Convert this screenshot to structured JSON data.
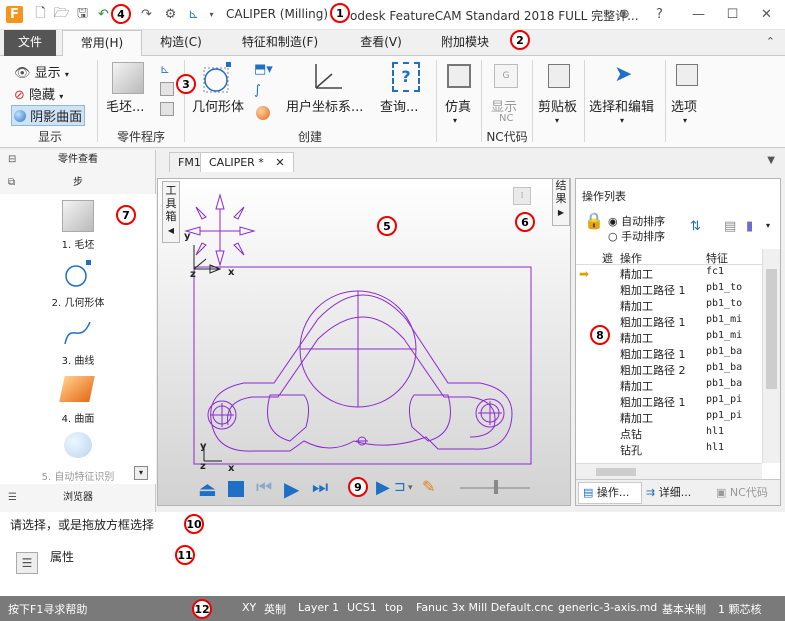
{
  "window": {
    "title_prefix": "CALIPER (Milling) -",
    "title_suffix": "odesk FeatureCAM Standard 2018 FULL 完整许..."
  },
  "menu_tabs": [
    {
      "label": "文件"
    },
    {
      "label": "常用(H)"
    },
    {
      "label": "构造(C)"
    },
    {
      "label": "特征和制造(F)"
    },
    {
      "label": "查看(V)"
    },
    {
      "label": "附加模块"
    }
  ],
  "ribbon": {
    "show": {
      "show_label": "显示",
      "hide_label": "隐藏",
      "shaded_label": "阴影曲面",
      "group_label": "显示"
    },
    "part_program": {
      "stock_label": "毛坯...",
      "group_label": "零件程序"
    },
    "create": {
      "geometry_label": "几何形体",
      "ucs_label": "用户坐标系...",
      "query_label": "查询...",
      "group_label": "创建"
    },
    "simulate_label": "仿真",
    "nc": {
      "show_label": "显示",
      "nc_small": "NC",
      "group_label": "NC代码"
    },
    "clipboard_label": "剪贴板",
    "select_edit_label": "选择和编辑",
    "options_label": "选项"
  },
  "sidebar": {
    "part_view_label": "零件查看",
    "steps_label": "步",
    "steps": [
      {
        "label": "1. 毛坯"
      },
      {
        "label": "2. 几何形体"
      },
      {
        "label": "3. 曲线"
      },
      {
        "label": "4. 曲面"
      },
      {
        "label": "5. 自动特征识别"
      }
    ],
    "browser_label": "浏览器"
  },
  "doc_tabs": [
    {
      "label": "FM1"
    },
    {
      "label": "CALIPER *"
    }
  ],
  "viewport": {
    "toolbox_label": "工具箱",
    "results_label": "结果",
    "axis_x": "x",
    "axis_y": "y",
    "axis_z": "z"
  },
  "operations": {
    "title": "操作列表",
    "auto_sort": "自动排序",
    "manual_sort": "手动排序",
    "col_mark": "遮",
    "col_op": "操作",
    "col_feature": "特征",
    "rows": [
      {
        "op": "精加工",
        "feature": "fc1"
      },
      {
        "op": "粗加工路径 1",
        "feature": "pb1_to"
      },
      {
        "op": "精加工",
        "feature": "pb1_to"
      },
      {
        "op": "粗加工路径 1",
        "feature": "pb1_mi"
      },
      {
        "op": "精加工",
        "feature": "pb1_mi"
      },
      {
        "op": "粗加工路径 1",
        "feature": "pb1_ba"
      },
      {
        "op": "粗加工路径 2",
        "feature": "pb1_ba"
      },
      {
        "op": "精加工",
        "feature": "pb1_ba"
      },
      {
        "op": "粗加工路径 1",
        "feature": "pp1_pi"
      },
      {
        "op": "精加工",
        "feature": "pp1_pi"
      },
      {
        "op": "点钻",
        "feature": "hl1"
      },
      {
        "op": "钻孔",
        "feature": "hl1"
      }
    ],
    "bottom_tabs": [
      {
        "label": "操作..."
      },
      {
        "label": "详细..."
      },
      {
        "label": "NC代码"
      }
    ]
  },
  "prompt_text": "请选择，或是拖放方框选择",
  "properties_label": "属性",
  "status": {
    "help": "按下F1寻求帮助",
    "plane": "XY",
    "units": "英制",
    "layer": "Layer 1",
    "ucs": "UCS1",
    "view": "top",
    "post": "Fanuc 3x Mill Default.cnc",
    "machine": "generic-3-axis.md",
    "metric": "基本米制",
    "core": "1 颗芯核"
  },
  "callouts": [
    "1",
    "2",
    "3",
    "4",
    "5",
    "6",
    "7",
    "8",
    "9",
    "10",
    "11",
    "12"
  ],
  "colors": {
    "accent_blue": "#1f6fc4",
    "geometry_purple": "#8b2ad0",
    "callout_red": "#e00000"
  }
}
